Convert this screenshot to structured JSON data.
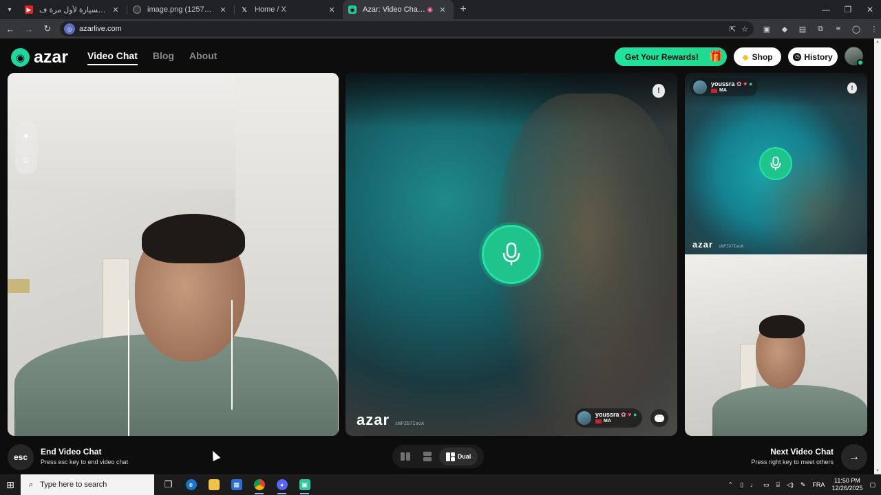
{
  "browser": {
    "tabs": [
      {
        "title": "فيرونيكا ساقة السيارة لأول مرة ف",
        "active": false,
        "favicon": "youtube-icon"
      },
      {
        "title": "image.png (1257×712)",
        "active": false,
        "favicon": "globe-icon"
      },
      {
        "title": "Home / X",
        "active": false,
        "favicon": "x-icon"
      },
      {
        "title": "Azar: Video Chat with New",
        "active": true,
        "favicon": "azar-icon"
      }
    ],
    "url": "azarlive.com",
    "tab_close": "✕",
    "new_tab": "+"
  },
  "header": {
    "logo_text": "azar",
    "nav": [
      {
        "label": "Video Chat",
        "active": true
      },
      {
        "label": "Blog",
        "active": false
      },
      {
        "label": "About",
        "active": false
      }
    ],
    "rewards_label": "Get Your Rewards!",
    "shop_label": "Shop",
    "history_label": "History"
  },
  "partner": {
    "name": "youssra",
    "country": "MA",
    "watermark_logo": "azar",
    "watermark_id": "sNPZb7IaoA"
  },
  "controls": {
    "esc_key": "esc",
    "end_title": "End Video Chat",
    "end_sub": "Press esc key to end video chat",
    "layout_active_label": "Dual",
    "next_title": "Next Video Chat",
    "next_sub": "Press right key to meet others"
  },
  "taskbar": {
    "search_placeholder": "Type here to search",
    "language": "FRA",
    "time": "11:50 PM",
    "date": "12/26/2025"
  },
  "colors": {
    "brand_green": "#1ed7a0",
    "mic_green": "#1fc48c",
    "background": "#0d0d0d"
  }
}
